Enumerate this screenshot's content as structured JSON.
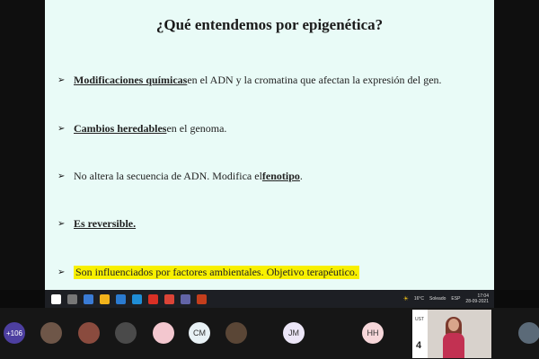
{
  "slide": {
    "title": "¿Qué entendemos por epigenética?",
    "bullets": [
      {
        "bold": "Modificaciones químicas",
        "rest": " en el ADN y la cromatina que afectan la expresión del gen."
      },
      {
        "bold": "Cambios heredables",
        "rest": " en el genoma."
      },
      {
        "pre": "No altera la secuencia de ADN. Modifica el ",
        "bold": "fenotipo",
        "rest": "."
      },
      {
        "bold": "Es reversible.",
        "rest": ""
      },
      {
        "highlight": "Son influenciados por factores ambientales. Objetivo terapéutico."
      }
    ]
  },
  "taskbar": {
    "temp": "16°C",
    "weather": "Soleado",
    "lang": "ESP",
    "time": "17:04",
    "date": "28-09-2021"
  },
  "participants": {
    "count_label": "+106",
    "initials": [
      "CM",
      "JM",
      "HH"
    ]
  },
  "video_panel": {
    "logo": "UST",
    "number": "4"
  },
  "colors": {
    "slide_bg": "#e9fbf7",
    "highlight": "#f8f000",
    "count_badge": "#4d3fa0"
  }
}
